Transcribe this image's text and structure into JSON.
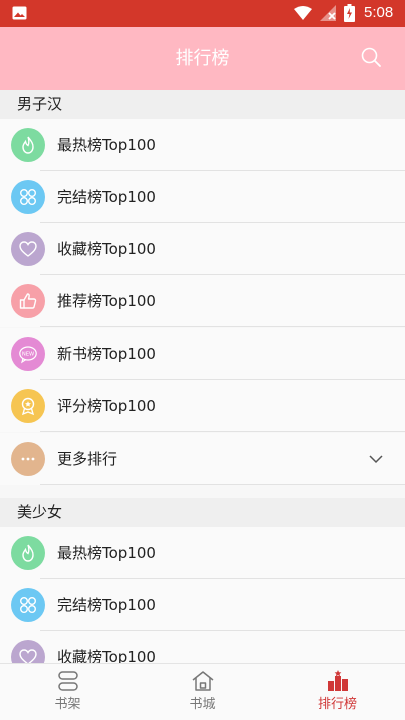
{
  "status_bar": {
    "time": "5:08"
  },
  "app_bar": {
    "title": "排行榜",
    "search_icon": "search-icon"
  },
  "sections": [
    {
      "header": "男子汉",
      "items": [
        {
          "label": "最热榜Top100",
          "icon": "flame-icon",
          "color": "#7ddba0"
        },
        {
          "label": "完结榜Top100",
          "icon": "grid-icon",
          "color": "#6cc8f3"
        },
        {
          "label": "收藏榜Top100",
          "icon": "heart-icon",
          "color": "#bba6cf"
        },
        {
          "label": "推荐榜Top100",
          "icon": "thumbs-up-icon",
          "color": "#f7a0a8"
        },
        {
          "label": "新书榜Top100",
          "icon": "new-badge-icon",
          "color": "#e48ad4"
        },
        {
          "label": "评分榜Top100",
          "icon": "award-icon",
          "color": "#f6c552"
        },
        {
          "label": "更多排行",
          "icon": "more-icon",
          "color": "#e2b58e"
        }
      ]
    },
    {
      "header": "美少女",
      "items": [
        {
          "label": "最热榜Top100",
          "icon": "flame-icon",
          "color": "#7ddba0"
        },
        {
          "label": "完结榜Top100",
          "icon": "grid-icon",
          "color": "#6cc8f3"
        },
        {
          "label": "收藏榜Top100",
          "icon": "heart-icon",
          "color": "#bba6cf"
        }
      ]
    }
  ],
  "bottom_nav": [
    {
      "label": "书架",
      "icon": "bookshelf-icon",
      "active": false
    },
    {
      "label": "书城",
      "icon": "bookstore-icon",
      "active": false
    },
    {
      "label": "排行榜",
      "icon": "ranking-icon",
      "active": true
    }
  ],
  "colors": {
    "status_bar": "#d3372a",
    "app_bar": "#ffb8c2",
    "active_tab": "#d03838"
  }
}
